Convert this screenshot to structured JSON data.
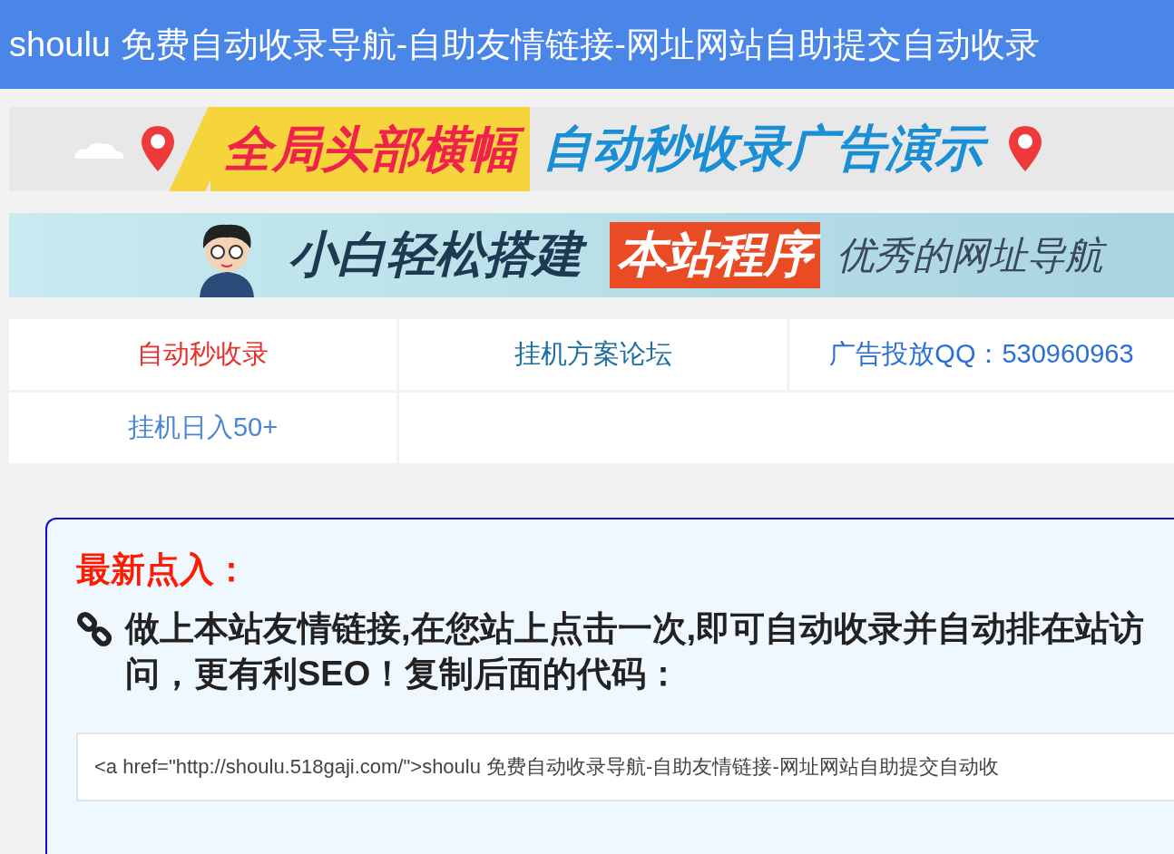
{
  "header": {
    "title": "shoulu 免费自动收录导航-自助友情链接-网址网站自助提交自动收录"
  },
  "banners": [
    {
      "kind": "pins",
      "parts": [
        "全局头部横幅",
        "自动秒收录广告演示"
      ]
    },
    {
      "kind": "cartoon",
      "parts": [
        "小白轻松搭建",
        "本站程序",
        "优秀的网址导航"
      ]
    }
  ],
  "nav": [
    {
      "label": "自动秒收录",
      "color": "#e8312a"
    },
    {
      "label": "挂机方案论坛",
      "color": "#1e6f9f"
    },
    {
      "label": "广告投放QQ：530960963",
      "color": "#2a6fd4"
    },
    {
      "label": "挂机日入50+",
      "color": "#4a86d8"
    }
  ],
  "notice": {
    "heading": "最新点入：",
    "text": "做上本站友情链接,在您站上点击一次,即可自动收录并自动排在站访问，更有利SEO！复制后面的代码：",
    "code": "<a href=\"http://shoulu.518gaji.com/\">shoulu 免费自动收录导航-自助友情链接-网址网站自助提交自动收"
  }
}
